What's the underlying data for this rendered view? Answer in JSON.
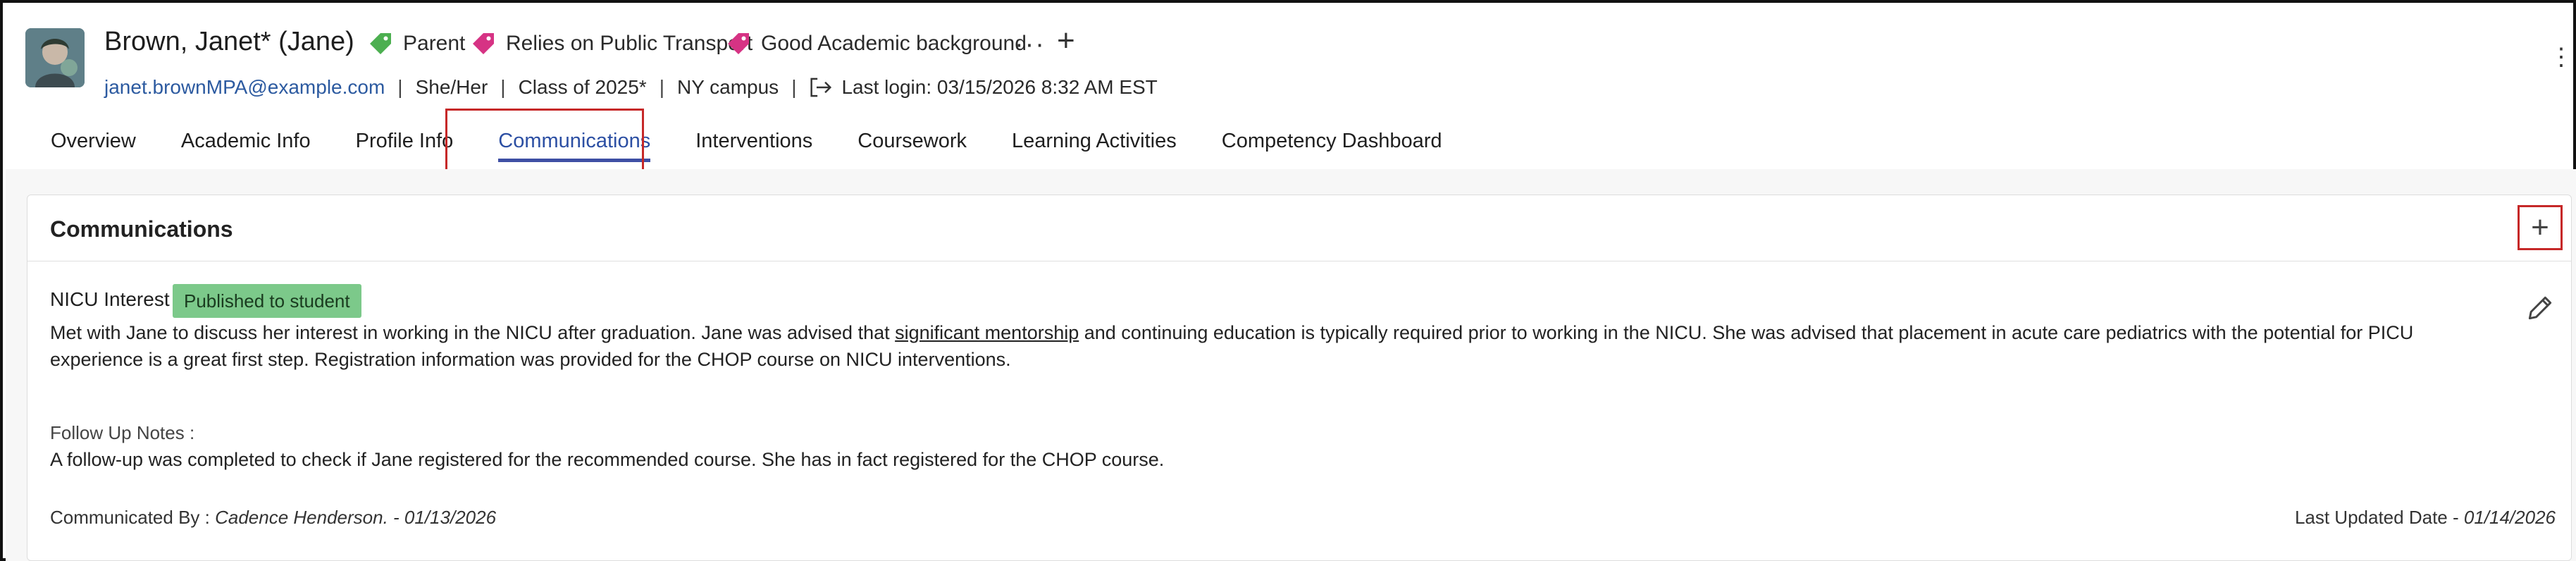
{
  "student": {
    "name": "Brown, Janet* (Jane)",
    "tags": [
      {
        "label": "Parent",
        "color": "#4caf50"
      },
      {
        "label": "Relies on Public Transport",
        "color": "#d63384"
      },
      {
        "label": "Good Academic background",
        "color": "#d63384"
      }
    ],
    "email": "janet.brownMPA@example.com",
    "pronouns": "She/Her",
    "class": "Class of 2025*",
    "campus": "NY campus",
    "last_login": "Last login: 03/15/2026 8:32 AM EST"
  },
  "header_actions": {
    "more": "···",
    "add": "+",
    "kebab": "⋮"
  },
  "tabs": [
    {
      "label": "Overview",
      "active": false
    },
    {
      "label": "Academic Info",
      "active": false
    },
    {
      "label": "Profile Info",
      "active": false
    },
    {
      "label": "Communications",
      "active": true
    },
    {
      "label": "Interventions",
      "active": false
    },
    {
      "label": "Coursework",
      "active": false
    },
    {
      "label": "Learning Activities",
      "active": false
    },
    {
      "label": "Competency Dashboard",
      "active": false
    }
  ],
  "communications": {
    "title": "Communications",
    "add_label": "+",
    "entry": {
      "title": "NICU Interest",
      "status": "Published to student",
      "desc_before": "Met with Jane to discuss her interest in working in the NICU after graduation. Jane was advised that ",
      "desc_link": "significant mentorship",
      "desc_after": " and continuing education is typically required prior to working in the NICU. She was advised that placement in acute care pediatrics with the potential for PICU experience is a great first step. Registration information was provided for the CHOP course on NICU interventions.",
      "followup_label": "Follow Up Notes :",
      "followup_text": "A follow-up was completed to check if Jane registered for the recommended course. She has in fact registered for the CHOP course.",
      "communicated_by_label": "Communicated By : ",
      "communicated_by": "Cadence Henderson. - 01/13/2026",
      "last_updated_label": "Last Updated Date - ",
      "last_updated": "01/14/2026"
    }
  }
}
